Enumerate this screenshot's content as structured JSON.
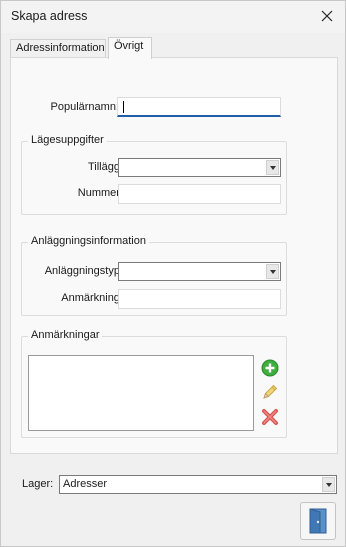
{
  "window": {
    "title": "Skapa adress"
  },
  "tabs": [
    {
      "label": "Adressinformation",
      "active": false
    },
    {
      "label": "Övrigt",
      "active": true
    }
  ],
  "fields": {
    "popularnamn": {
      "label": "Populärnamn:",
      "value": ""
    }
  },
  "lagesuppgifter": {
    "title": "Lägesuppgifter",
    "tillagg": {
      "label": "Tillägg:",
      "value": ""
    },
    "nummer": {
      "label": "Nummer:",
      "value": ""
    }
  },
  "anlaggning": {
    "title": "Anläggningsinformation",
    "typ": {
      "label": "Anläggningstyp:",
      "value": ""
    },
    "anmarkning": {
      "label": "Anmärkning:",
      "value": ""
    }
  },
  "anmarkningar": {
    "title": "Anmärkningar",
    "items": [],
    "icons": [
      "add-icon",
      "edit-pencil-icon",
      "delete-x-icon"
    ]
  },
  "footer": {
    "lager_label": "Lager:",
    "lager_value": "Adresser",
    "exit_icon": "door-exit-icon"
  },
  "colors": {
    "focus_underline": "#1f5fa8",
    "add_green": "#3fae3f",
    "delete_red": "#d9534f"
  }
}
